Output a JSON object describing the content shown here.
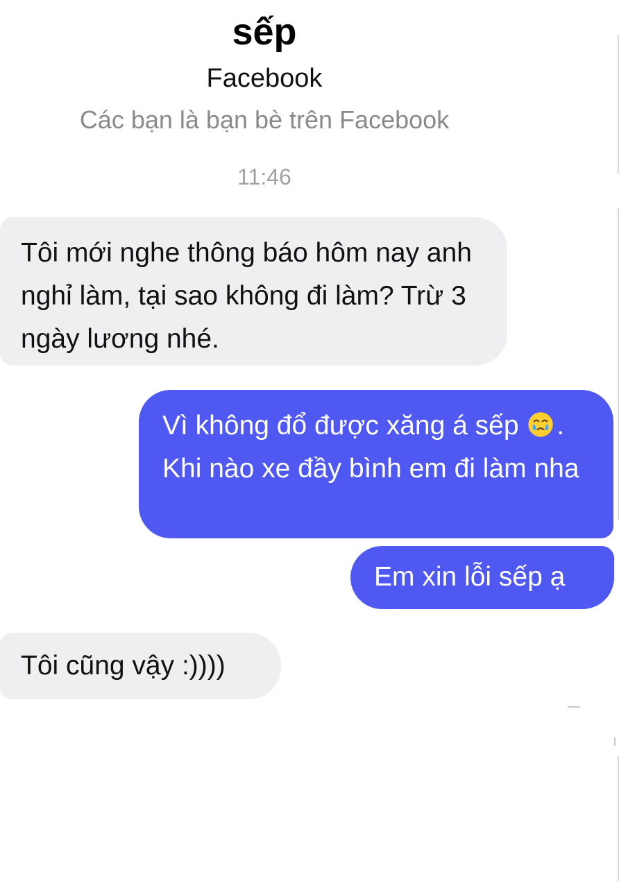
{
  "header": {
    "contact_name": "sếp",
    "platform": "Facebook",
    "friend_status": "Các bạn là bạn bè trên Facebook"
  },
  "timestamp": "11:46",
  "messages": [
    {
      "sender": "incoming",
      "text": "Tôi mới nghe thông báo hôm nay anh nghỉ làm, tại sao không đi làm? Trừ 3 ngày lương nhé."
    },
    {
      "sender": "outgoing",
      "text_before_emoji": "Vì không đổ được xăng á sếp ",
      "emoji": "face-holding-back-tears-icon",
      "text_after_emoji": ". Khi nào xe đầy bình em đi làm nha"
    },
    {
      "sender": "outgoing",
      "text": "Em xin lỗi sếp ạ"
    },
    {
      "sender": "incoming",
      "text": "Tôi cũng vậy :))))"
    }
  ],
  "colors": {
    "incoming_bubble": "#efeff1",
    "outgoing_bubble": "#4f58f0",
    "outgoing_text": "#ffffff",
    "secondary_text": "#8a8a8e",
    "timestamp_text": "#a0a0a5"
  }
}
